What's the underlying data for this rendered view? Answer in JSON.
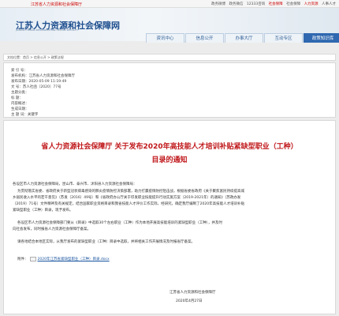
{
  "topbar": {
    "site": "江苏省人力资源和社会保障厅",
    "links": [
      "政务微博",
      "政务微信",
      "12333咨询",
      "社会保障",
      "社会保障",
      "人力资源",
      "人事人才"
    ]
  },
  "header": {
    "logo": "江苏人力资源和社会保障网",
    "logo_sub": "JIANGSU HUMAN RESOURCES AND SOCIAL SECURITY"
  },
  "nav": {
    "tabs": [
      {
        "label": "资讯中心"
      },
      {
        "label": "信息公开"
      },
      {
        "label": "办事大厅"
      },
      {
        "label": "互动专区"
      },
      {
        "label": "政策知识库"
      }
    ]
  },
  "breadcrumb": "文档位置：首页 > 信息公开 > 政策法规",
  "meta": {
    "index": "索 引 号：",
    "publisher": "发布机构：江苏省人力资源和社会保障厅",
    "date": "发布日期：2020-05-09 11:19:49",
    "docno": "文    号：苏人社函〔2020〕77号",
    "category": "主题分类：",
    "title": "标    题：",
    "content_label": "内容概述：",
    "generated": "生成日期：",
    "keywords": "主 题 词：关键字"
  },
  "article": {
    "title_line1": "省人力资源社会保障厅 关于发布2020年高技能人才培训补贴紧缺型职业（工种）",
    "title_line2": "目录的通知",
    "addressee": "各设区市人力资源社会保障局，昆山市、泰兴市、沭阳县人力资源社会保障局：",
    "paragraphs": [
      "为贯彻落实省委、省政府关于新型冠状病毒感染的肺炎疫情防控决策部署，助力打赢疫情防控阻击战，根据省委省政府《关于聚焦富民持续提高城",
      "乡居民收入水平的若干意见》（苏发〔2016〕49号）和《省政府办公厅关于印发职业技能提升行动实施方案（2019-2021年）的通知》（苏政办发",
      "〔2019〕71号）文件精神及有关规定，结合国家职业资格目录和我省技能人才评价工作实际，经研究，确定我厅编制了2020年高技能人才培训补贴",
      "紧缺型职业（工种）目录，现予发布。",
      "各设区市人力资源社会保障部门要从《目录》中选取30个左右职业（工种）作为本地开展高技能培训的紧缺型职业（工种），并及时",
      "向社会发布，同时报省人力资源社会保障厅备案。",
      "请各地结合本地区实际，从我厅发布的紧缺型职业（工种）目录中选取，并将相关工作开展情况及时报省厅备案。"
    ],
    "attachment_label": "附件：",
    "attachment_file": "2020年江苏省紧缺型职业（工种）目录.docx",
    "signature": "江苏省人力资源和社会保障厅",
    "sign_date": "2020年4月27日"
  }
}
